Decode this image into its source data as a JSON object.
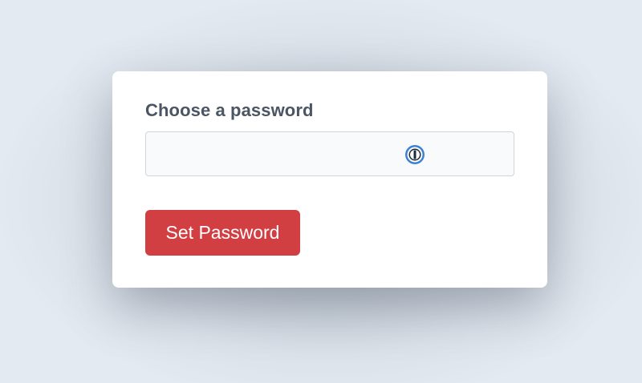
{
  "form": {
    "label": "Choose a password",
    "password_value": "",
    "password_manager_icon": "password-manager-icon",
    "submit_label": "Set Password"
  },
  "colors": {
    "button_bg": "#d13f43",
    "label_text": "#4b5563",
    "card_bg": "#ffffff",
    "page_bg": "#e3e9f1",
    "icon_blue": "#3b82d6"
  }
}
